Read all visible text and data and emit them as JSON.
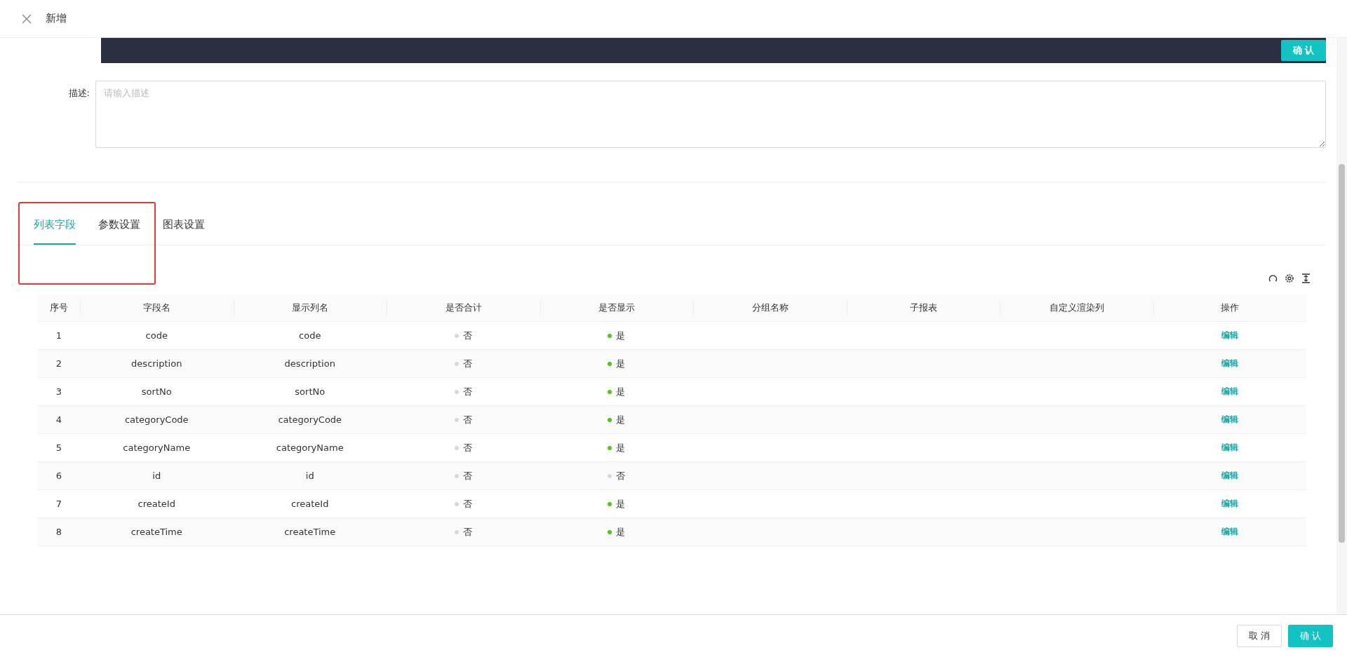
{
  "header": {
    "title": "新增"
  },
  "editor": {
    "confirm": "确 认"
  },
  "description": {
    "label": "描述:",
    "placeholder": "请输入描述"
  },
  "tabs": [
    {
      "label": "列表字段",
      "selected": true
    },
    {
      "label": "参数设置",
      "selected": false
    },
    {
      "label": "图表设置",
      "selected": false
    }
  ],
  "table": {
    "columns": [
      "序号",
      "字段名",
      "显示列名",
      "是否合计",
      "是否显示",
      "分组名称",
      "子报表",
      "自定义渲染列",
      "操作"
    ],
    "rows": [
      {
        "index": "1",
        "field": "code",
        "display": "code",
        "sum": {
          "text": "否",
          "on": false
        },
        "show": {
          "text": "是",
          "on": true
        },
        "action": "编辑"
      },
      {
        "index": "2",
        "field": "description",
        "display": "description",
        "sum": {
          "text": "否",
          "on": false
        },
        "show": {
          "text": "是",
          "on": true
        },
        "action": "编辑"
      },
      {
        "index": "3",
        "field": "sortNo",
        "display": "sortNo",
        "sum": {
          "text": "否",
          "on": false
        },
        "show": {
          "text": "是",
          "on": true
        },
        "action": "编辑"
      },
      {
        "index": "4",
        "field": "categoryCode",
        "display": "categoryCode",
        "sum": {
          "text": "否",
          "on": false
        },
        "show": {
          "text": "是",
          "on": true
        },
        "action": "编辑"
      },
      {
        "index": "5",
        "field": "categoryName",
        "display": "categoryName",
        "sum": {
          "text": "否",
          "on": false
        },
        "show": {
          "text": "是",
          "on": true
        },
        "action": "编辑"
      },
      {
        "index": "6",
        "field": "id",
        "display": "id",
        "sum": {
          "text": "否",
          "on": false
        },
        "show": {
          "text": "否",
          "on": false
        },
        "action": "编辑"
      },
      {
        "index": "7",
        "field": "createId",
        "display": "createId",
        "sum": {
          "text": "否",
          "on": false
        },
        "show": {
          "text": "是",
          "on": true
        },
        "action": "编辑"
      },
      {
        "index": "8",
        "field": "createTime",
        "display": "createTime",
        "sum": {
          "text": "否",
          "on": false
        },
        "show": {
          "text": "是",
          "on": true
        },
        "action": "编辑"
      }
    ]
  },
  "footer": {
    "cancel": "取 消",
    "confirm": "确 认"
  }
}
